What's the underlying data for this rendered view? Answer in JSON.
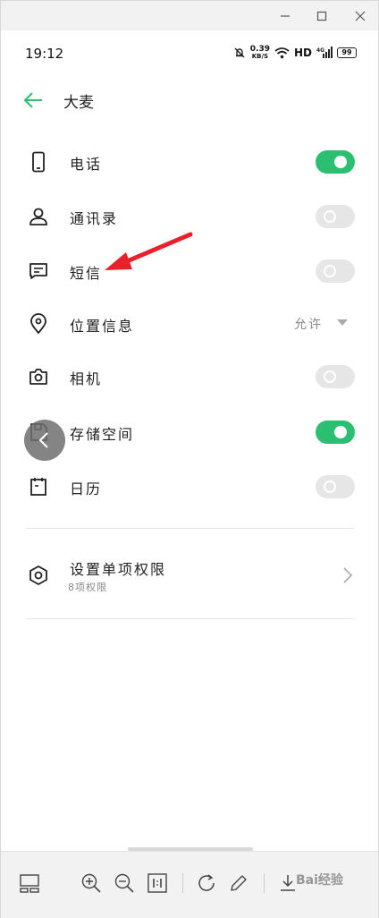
{
  "status_bar": {
    "time": "19:12",
    "net_speed_value": "0.39",
    "net_speed_unit": "KB/S",
    "hd_label": "HD",
    "signal_label": "4G",
    "battery": "99"
  },
  "header": {
    "title": "大麦"
  },
  "permissions": [
    {
      "label": "电话",
      "icon": "phone-icon",
      "type": "toggle",
      "on": true
    },
    {
      "label": "通讯录",
      "icon": "contact-icon",
      "type": "toggle",
      "on": false
    },
    {
      "label": "短信",
      "icon": "message-icon",
      "type": "toggle",
      "on": false
    },
    {
      "label": "位置信息",
      "icon": "location-icon",
      "type": "select",
      "value": "允许"
    },
    {
      "label": "相机",
      "icon": "camera-icon",
      "type": "toggle",
      "on": false
    },
    {
      "label": "存储空间",
      "icon": "storage-icon",
      "type": "toggle",
      "on": true
    },
    {
      "label": "日历",
      "icon": "calendar-icon",
      "type": "toggle",
      "on": false
    }
  ],
  "single_permissions": {
    "title": "设置单项权限",
    "subtitle": "8项权限"
  },
  "watermark": "Bai经验",
  "colors": {
    "accent": "#2bbf72",
    "toggle_off": "#e6e6e6",
    "annotation_arrow": "#e8202a"
  }
}
